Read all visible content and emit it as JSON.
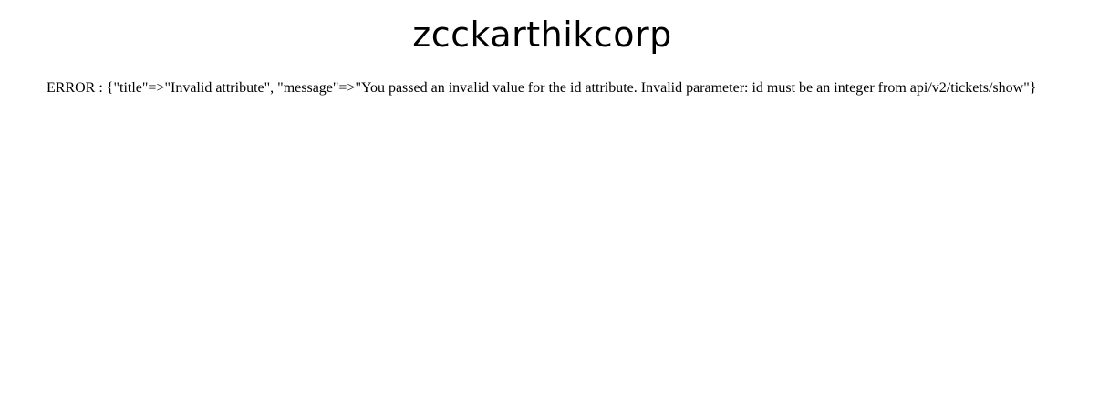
{
  "header": {
    "title": "zcckarthikcorp"
  },
  "main": {
    "error_text": "ERROR : {\"title\"=>\"Invalid attribute\", \"message\"=>\"You passed an invalid value for the id attribute. Invalid parameter: id must be an integer from api/v2/tickets/show\"}"
  }
}
